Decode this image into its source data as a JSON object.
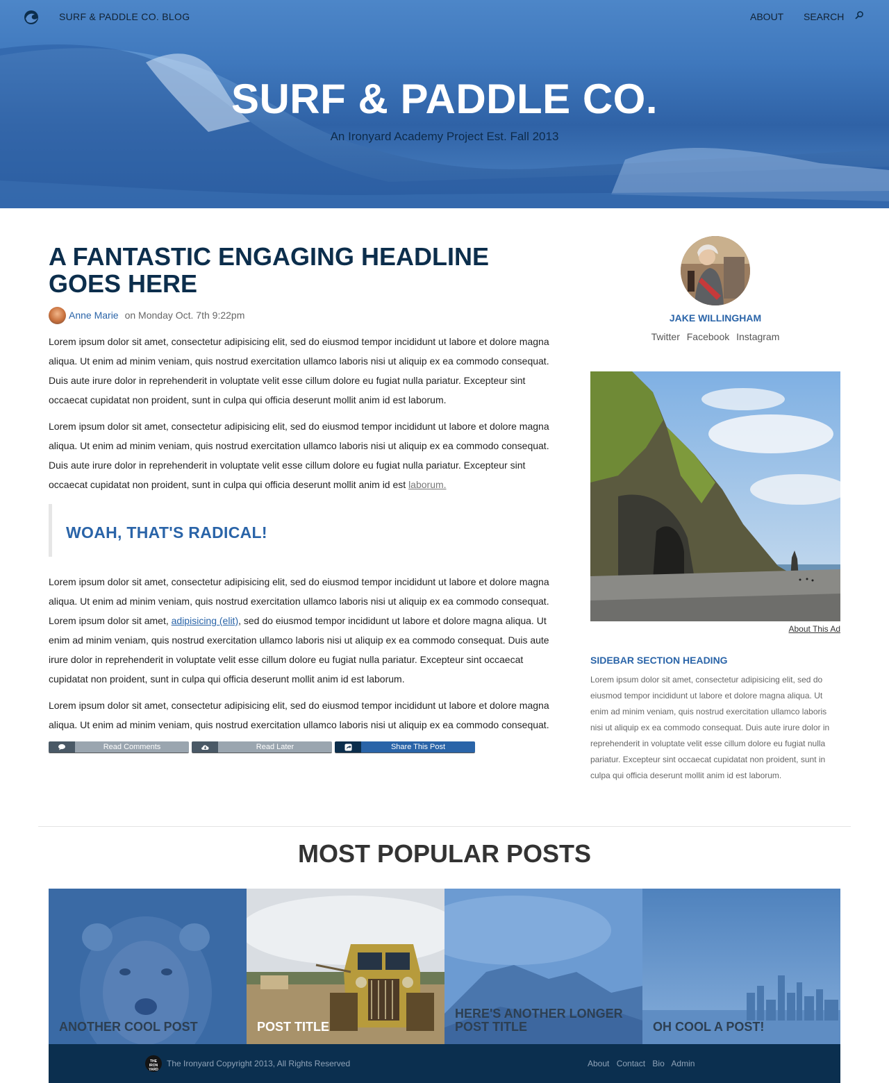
{
  "nav": {
    "blog_name": "SURF & PADDLE CO. BLOG",
    "about": "ABOUT",
    "search": "SEARCH"
  },
  "hero": {
    "title": "SURF & PADDLE CO.",
    "subtitle": "An Ironyard Academy Project Est. Fall 2013"
  },
  "article": {
    "headline": "A FANTASTIC ENGAGING HEADLINE GOES HERE",
    "author": "Anne Marie",
    "date": "on Monday Oct. 7th 9:22pm",
    "p1": "Lorem ipsum dolor sit amet, consectetur adipisicing elit, sed do eiusmod tempor incididunt ut labore et dolore magna aliqua. Ut enim ad minim veniam, quis nostrud exercitation ullamco laboris nisi ut aliquip ex ea commodo consequat. Duis aute irure dolor in reprehenderit in voluptate velit esse cillum dolore eu fugiat nulla pariatur. Excepteur sint occaecat cupidatat non proident, sunt in culpa qui officia deserunt mollit anim id est laborum.",
    "p2_text": "Lorem ipsum dolor sit amet, consectetur adipisicing elit, sed do eiusmod tempor incididunt ut labore et dolore magna aliqua. Ut enim ad minim veniam, quis nostrud exercitation ullamco laboris nisi ut aliquip ex ea commodo consequat. Duis aute irure dolor in reprehenderit in voluptate velit esse cillum dolore eu fugiat nulla pariatur. Excepteur sint occaecat cupidatat non proident, sunt in culpa qui officia deserunt mollit anim id est ",
    "p2_link": "laborum.",
    "quote": "WOAH, THAT'S RADICAL!",
    "p3_before": "Lorem ipsum dolor sit amet, consectetur adipisicing elit, sed do eiusmod tempor incididunt ut labore et dolore magna aliqua. Ut enim ad minim veniam, quis nostrud exercitation ullamco laboris nisi ut aliquip ex ea commodo consequat. Lorem ipsum dolor sit amet, ",
    "p3_link": "adipisicing (elit)",
    "p3_after": ", sed do eiusmod tempor incididunt ut labore et dolore magna aliqua. Ut enim ad minim veniam, quis nostrud exercitation ullamco laboris nisi ut aliquip ex ea commodo consequat. Duis aute irure dolor in reprehenderit in voluptate velit esse cillum dolore eu fugiat nulla pariatur. Excepteur sint occaecat cupidatat non proident, sunt in culpa qui officia deserunt mollit anim id est laborum.",
    "p4": "Lorem ipsum dolor sit amet, consectetur adipisicing elit, sed do eiusmod tempor incididunt ut labore et dolore magna aliqua. Ut enim ad minim veniam, quis nostrud exercitation ullamco laboris nisi ut aliquip ex ea commodo consequat.",
    "actions": {
      "comments": "Read Comments",
      "later": "Read Later",
      "share": "Share This Post"
    }
  },
  "sidebar": {
    "profile_name": "JAKE WILLINGHAM",
    "socials": [
      "Twitter",
      "Facebook",
      "Instagram"
    ],
    "about_ad": "About This Ad",
    "section_heading": "SIDEBAR SECTION HEADING",
    "section_text": "Lorem ipsum dolor sit amet, consectetur adipisicing elit, sed do eiusmod tempor incididunt ut labore et dolore magna aliqua. Ut enim ad minim veniam, quis nostrud exercitation ullamco laboris nisi ut aliquip ex ea commodo consequat. Duis aute irure dolor in reprehenderit in voluptate velit esse cillum dolore eu fugiat nulla pariatur. Excepteur sint occaecat cupidatat non proident, sunt in culpa qui officia deserunt mollit anim id est laborum."
  },
  "popular": {
    "heading": "MOST POPULAR POSTS",
    "tiles": [
      {
        "title": "ANOTHER COOL POST"
      },
      {
        "title": "POST TITLE"
      },
      {
        "title": "HERE'S ANOTHER LONGER POST TITLE"
      },
      {
        "title": "OH COOL A POST!"
      }
    ]
  },
  "footer": {
    "copyright": "The Ironyard Copyright 2013, All Rights Reserved",
    "links": [
      "About",
      "Contact",
      "Bio",
      "Admin"
    ]
  },
  "colors": {
    "brand_dark": "#0c2e4c",
    "accent_blue": "#2a64a8",
    "footer_bg": "#0b2f4f"
  }
}
